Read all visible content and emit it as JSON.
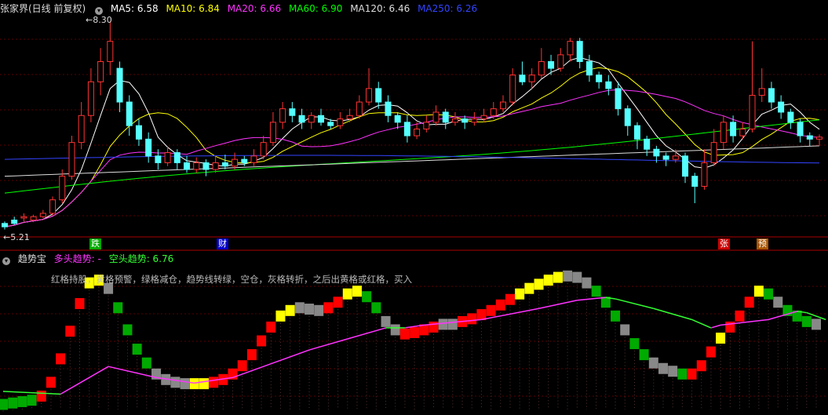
{
  "main_header": {
    "stock": "张家界(日线 前复权)",
    "ma": [
      {
        "label": "MA5: 6.58",
        "color": "#ffffff"
      },
      {
        "label": "MA10: 6.84",
        "color": "#ffff00"
      },
      {
        "label": "MA20: 6.66",
        "color": "#ff33ff"
      },
      {
        "label": "MA60: 6.90",
        "color": "#00ff00"
      },
      {
        "label": "MA120: 6.46",
        "color": "#dddddd"
      },
      {
        "label": "MA250: 6.26",
        "color": "#3344ff"
      }
    ]
  },
  "price_labels": {
    "high": "8.30",
    "low": "5.21"
  },
  "badges": [
    {
      "text": "跌",
      "bg": "#00aa00"
    },
    {
      "text": "财",
      "bg": "#0000cc"
    },
    {
      "text": "张",
      "bg": "#cc0000"
    },
    {
      "text": "预",
      "bg": "#aa5500"
    }
  ],
  "sub_header": {
    "name": "趋势宝",
    "long_label": "多头趋势: -",
    "short_label": "空头趋势: 6.76",
    "note": "红格持股，黄格预警，绿格减仓，趋势线转绿，空仓，灰格转折，之后出黄格或红格，买入"
  },
  "colors": {
    "up": "#ff3333",
    "down": "#55ffff",
    "grid": "#5a0000",
    "cell_red": "#ff0000",
    "cell_yellow": "#ffff00",
    "cell_green": "#00aa00",
    "cell_gray": "#888888",
    "trend_up": "#ff33ff",
    "trend_down": "#33ff33"
  },
  "chart_data": [
    {
      "type": "candlestick",
      "title": "张家界(日线 前复权)",
      "ylim": [
        5.1,
        8.45
      ],
      "candles": [
        [
          5.3,
          5.25,
          5.33,
          5.21
        ],
        [
          5.35,
          5.3,
          5.4,
          5.28
        ],
        [
          5.38,
          5.4,
          5.45,
          5.33
        ],
        [
          5.35,
          5.4,
          5.43,
          5.32
        ],
        [
          5.4,
          5.45,
          5.5,
          5.38
        ],
        [
          5.45,
          5.65,
          5.7,
          5.42
        ],
        [
          5.65,
          6.0,
          6.1,
          5.6
        ],
        [
          6.0,
          6.5,
          6.6,
          5.95
        ],
        [
          6.5,
          6.9,
          7.1,
          6.4
        ],
        [
          6.9,
          7.4,
          7.6,
          6.8
        ],
        [
          7.4,
          7.7,
          7.9,
          7.2
        ],
        [
          7.7,
          8.0,
          8.3,
          7.5
        ],
        [
          7.6,
          7.1,
          7.7,
          6.95
        ],
        [
          7.1,
          6.75,
          7.2,
          6.6
        ],
        [
          6.75,
          6.55,
          6.85,
          6.45
        ],
        [
          6.55,
          6.3,
          6.65,
          6.2
        ],
        [
          6.3,
          6.2,
          6.4,
          6.1
        ],
        [
          6.2,
          6.35,
          6.45,
          6.15
        ],
        [
          6.35,
          6.2,
          6.4,
          6.1
        ],
        [
          6.2,
          6.1,
          6.3,
          6.05
        ],
        [
          6.1,
          6.2,
          6.28,
          6.05
        ],
        [
          6.2,
          6.1,
          6.25,
          6.0
        ],
        [
          6.1,
          6.2,
          6.3,
          6.05
        ],
        [
          6.2,
          6.15,
          6.32,
          6.1
        ],
        [
          6.15,
          6.25,
          6.35,
          6.1
        ],
        [
          6.25,
          6.2,
          6.3,
          6.15
        ],
        [
          6.2,
          6.3,
          6.4,
          6.15
        ],
        [
          6.3,
          6.5,
          6.6,
          6.25
        ],
        [
          6.5,
          6.8,
          6.95,
          6.45
        ],
        [
          6.8,
          7.0,
          7.1,
          6.7
        ],
        [
          7.0,
          6.9,
          7.1,
          6.8
        ],
        [
          6.9,
          6.8,
          7.0,
          6.7
        ],
        [
          6.8,
          6.9,
          6.95,
          6.7
        ],
        [
          6.9,
          6.8,
          7.0,
          6.75
        ],
        [
          6.8,
          6.75,
          6.85,
          6.7
        ],
        [
          6.75,
          6.85,
          6.95,
          6.7
        ],
        [
          6.85,
          6.9,
          7.0,
          6.8
        ],
        [
          6.9,
          7.1,
          7.2,
          6.85
        ],
        [
          7.1,
          7.3,
          7.6,
          7.05
        ],
        [
          7.3,
          7.1,
          7.4,
          7.0
        ],
        [
          7.1,
          6.9,
          7.2,
          6.8
        ],
        [
          6.9,
          6.8,
          6.95,
          6.7
        ],
        [
          6.8,
          6.6,
          6.9,
          6.5
        ],
        [
          6.6,
          6.7,
          6.8,
          6.55
        ],
        [
          6.7,
          6.8,
          6.9,
          6.65
        ],
        [
          6.8,
          6.95,
          7.05,
          6.75
        ],
        [
          6.95,
          6.8,
          7.0,
          6.7
        ],
        [
          6.8,
          6.85,
          6.95,
          6.75
        ],
        [
          6.85,
          6.8,
          6.9,
          6.7
        ],
        [
          6.8,
          6.85,
          6.95,
          6.75
        ],
        [
          6.85,
          6.9,
          7.0,
          6.8
        ],
        [
          6.9,
          7.0,
          7.1,
          6.85
        ],
        [
          7.0,
          7.1,
          7.2,
          6.95
        ],
        [
          7.1,
          7.5,
          7.6,
          7.05
        ],
        [
          7.5,
          7.4,
          7.7,
          7.35
        ],
        [
          7.4,
          7.5,
          7.6,
          7.3
        ],
        [
          7.5,
          7.7,
          7.9,
          7.45
        ],
        [
          7.7,
          7.6,
          7.8,
          7.5
        ],
        [
          7.6,
          7.8,
          7.9,
          7.55
        ],
        [
          7.8,
          8.0,
          8.05,
          7.7
        ],
        [
          8.0,
          7.7,
          8.05,
          7.6
        ],
        [
          7.7,
          7.5,
          7.8,
          7.4
        ],
        [
          7.5,
          7.4,
          7.55,
          7.3
        ],
        [
          7.4,
          7.3,
          7.5,
          7.2
        ],
        [
          7.3,
          7.0,
          7.4,
          6.9
        ],
        [
          7.0,
          6.75,
          7.05,
          6.6
        ],
        [
          6.75,
          6.55,
          6.8,
          6.4
        ],
        [
          6.55,
          6.4,
          6.6,
          6.3
        ],
        [
          6.4,
          6.3,
          6.45,
          6.2
        ],
        [
          6.3,
          6.25,
          6.35,
          6.15
        ],
        [
          6.25,
          6.3,
          6.4,
          6.2
        ],
        [
          6.3,
          6.0,
          6.35,
          5.9
        ],
        [
          6.0,
          5.85,
          6.05,
          5.6
        ],
        [
          5.85,
          6.2,
          6.4,
          5.8
        ],
        [
          6.2,
          6.5,
          6.7,
          6.15
        ],
        [
          6.5,
          6.8,
          6.9,
          6.4
        ],
        [
          6.8,
          6.6,
          6.9,
          6.5
        ],
        [
          6.6,
          6.7,
          6.8,
          6.55
        ],
        [
          6.7,
          7.2,
          8.0,
          6.65
        ],
        [
          7.2,
          7.3,
          7.6,
          7.1
        ],
        [
          7.3,
          7.1,
          7.4,
          7.0
        ],
        [
          7.1,
          6.95,
          7.2,
          6.85
        ],
        [
          6.95,
          6.8,
          7.0,
          6.7
        ],
        [
          6.8,
          6.6,
          6.85,
          6.5
        ],
        [
          6.6,
          6.55,
          6.65,
          6.45
        ],
        [
          6.55,
          6.58,
          6.62,
          6.45
        ]
      ]
    },
    {
      "type": "heatmap",
      "title": "趋势宝",
      "ylim": [
        0,
        100
      ],
      "cells": [
        [
          2,
          "green"
        ],
        [
          3,
          "green"
        ],
        [
          4,
          "green"
        ],
        [
          5,
          "green"
        ],
        [
          8,
          "red"
        ],
        [
          18,
          "red"
        ],
        [
          35,
          "red"
        ],
        [
          55,
          "red"
        ],
        [
          75,
          "red"
        ],
        [
          90,
          "yellow"
        ],
        [
          92,
          "yellow"
        ],
        [
          86,
          "gray"
        ],
        [
          72,
          "green"
        ],
        [
          56,
          "green"
        ],
        [
          42,
          "green"
        ],
        [
          32,
          "green"
        ],
        [
          24,
          "gray"
        ],
        [
          20,
          "gray"
        ],
        [
          18,
          "gray"
        ],
        [
          17,
          "gray"
        ],
        [
          17,
          "yellow"
        ],
        [
          17,
          "yellow"
        ],
        [
          18,
          "red"
        ],
        [
          20,
          "red"
        ],
        [
          24,
          "red"
        ],
        [
          30,
          "red"
        ],
        [
          38,
          "red"
        ],
        [
          48,
          "red"
        ],
        [
          58,
          "red"
        ],
        [
          66,
          "yellow"
        ],
        [
          70,
          "yellow"
        ],
        [
          72,
          "gray"
        ],
        [
          71,
          "gray"
        ],
        [
          70,
          "gray"
        ],
        [
          72,
          "red"
        ],
        [
          76,
          "red"
        ],
        [
          82,
          "yellow"
        ],
        [
          84,
          "yellow"
        ],
        [
          80,
          "green"
        ],
        [
          72,
          "green"
        ],
        [
          62,
          "gray"
        ],
        [
          56,
          "gray"
        ],
        [
          53,
          "red"
        ],
        [
          54,
          "red"
        ],
        [
          56,
          "red"
        ],
        [
          58,
          "red"
        ],
        [
          60,
          "gray"
        ],
        [
          60,
          "gray"
        ],
        [
          62,
          "red"
        ],
        [
          64,
          "red"
        ],
        [
          67,
          "red"
        ],
        [
          70,
          "red"
        ],
        [
          74,
          "red"
        ],
        [
          78,
          "red"
        ],
        [
          82,
          "yellow"
        ],
        [
          86,
          "yellow"
        ],
        [
          89,
          "yellow"
        ],
        [
          92,
          "yellow"
        ],
        [
          94,
          "yellow"
        ],
        [
          95,
          "gray"
        ],
        [
          94,
          "gray"
        ],
        [
          90,
          "gray"
        ],
        [
          84,
          "green"
        ],
        [
          76,
          "green"
        ],
        [
          66,
          "green"
        ],
        [
          56,
          "gray"
        ],
        [
          46,
          "green"
        ],
        [
          38,
          "green"
        ],
        [
          32,
          "gray"
        ],
        [
          28,
          "gray"
        ],
        [
          26,
          "gray"
        ],
        [
          24,
          "green"
        ],
        [
          24,
          "red"
        ],
        [
          30,
          "red"
        ],
        [
          40,
          "red"
        ],
        [
          50,
          "yellow"
        ],
        [
          58,
          "red"
        ],
        [
          66,
          "red"
        ],
        [
          76,
          "red"
        ],
        [
          84,
          "yellow"
        ],
        [
          82,
          "green"
        ],
        [
          76,
          "gray"
        ],
        [
          70,
          "green"
        ],
        [
          66,
          "green"
        ],
        [
          62,
          "green"
        ],
        [
          60,
          "gray"
        ]
      ],
      "trend": [
        [
          0,
          12,
          "green"
        ],
        [
          6,
          10,
          "green"
        ],
        [
          8,
          18,
          "magenta"
        ],
        [
          11,
          30,
          "magenta"
        ],
        [
          16,
          22,
          "magenta"
        ],
        [
          20,
          18,
          "magenta"
        ],
        [
          24,
          22,
          "magenta"
        ],
        [
          28,
          32,
          "magenta"
        ],
        [
          32,
          42,
          "magenta"
        ],
        [
          36,
          50,
          "magenta"
        ],
        [
          40,
          58,
          "magenta"
        ],
        [
          42,
          58,
          "green"
        ],
        [
          44,
          60,
          "magenta"
        ],
        [
          50,
          64,
          "magenta"
        ],
        [
          56,
          72,
          "magenta"
        ],
        [
          60,
          78,
          "magenta"
        ],
        [
          63,
          80,
          "magenta"
        ],
        [
          64,
          79,
          "green"
        ],
        [
          68,
          72,
          "green"
        ],
        [
          72,
          64,
          "green"
        ],
        [
          74,
          58,
          "green"
        ],
        [
          75,
          60,
          "magenta"
        ],
        [
          80,
          64,
          "magenta"
        ],
        [
          83,
          70,
          "magenta"
        ],
        [
          84,
          69,
          "green"
        ],
        [
          86,
          64,
          "green"
        ]
      ]
    }
  ]
}
